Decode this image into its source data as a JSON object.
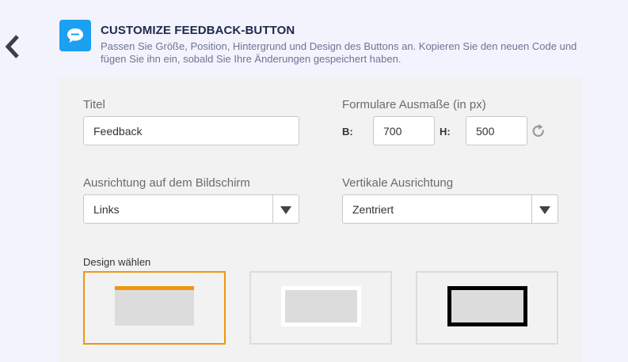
{
  "header": {
    "title": "CUSTOMIZE FEEDBACK-BUTTON",
    "description": "Passen Sie Größe, Position, Hintergrund und Design des Buttons an. Kopieren Sie den neuen Code und fügen Sie ihn ein, sobald Sie Ihre Änderungen gespeichert haben."
  },
  "form": {
    "title_label": "Titel",
    "title_value": "Feedback",
    "dimensions_label": "Formulare Ausmaße (in px)",
    "width_label": "B:",
    "width_value": "700",
    "height_label": "H:",
    "height_value": "500",
    "screen_alignment_label": "Ausrichtung auf dem Bildschirm",
    "screen_alignment_value": "Links",
    "vertical_alignment_label": "Vertikale Ausrichtung",
    "vertical_alignment_value": "Zentriert",
    "design_label": "Design wählen"
  },
  "designs": [
    "top-bar",
    "white-frame",
    "black-frame"
  ],
  "selected_design": "top-bar",
  "colors": {
    "accent": "#f0960e",
    "icon_blue": "#1ca0f2",
    "panel": "#f2f2f2",
    "background": "#f3f3fd"
  },
  "icons": [
    "back-arrow-icon",
    "chat-bubble-icon",
    "refresh-icon",
    "chevron-down-icon"
  ]
}
